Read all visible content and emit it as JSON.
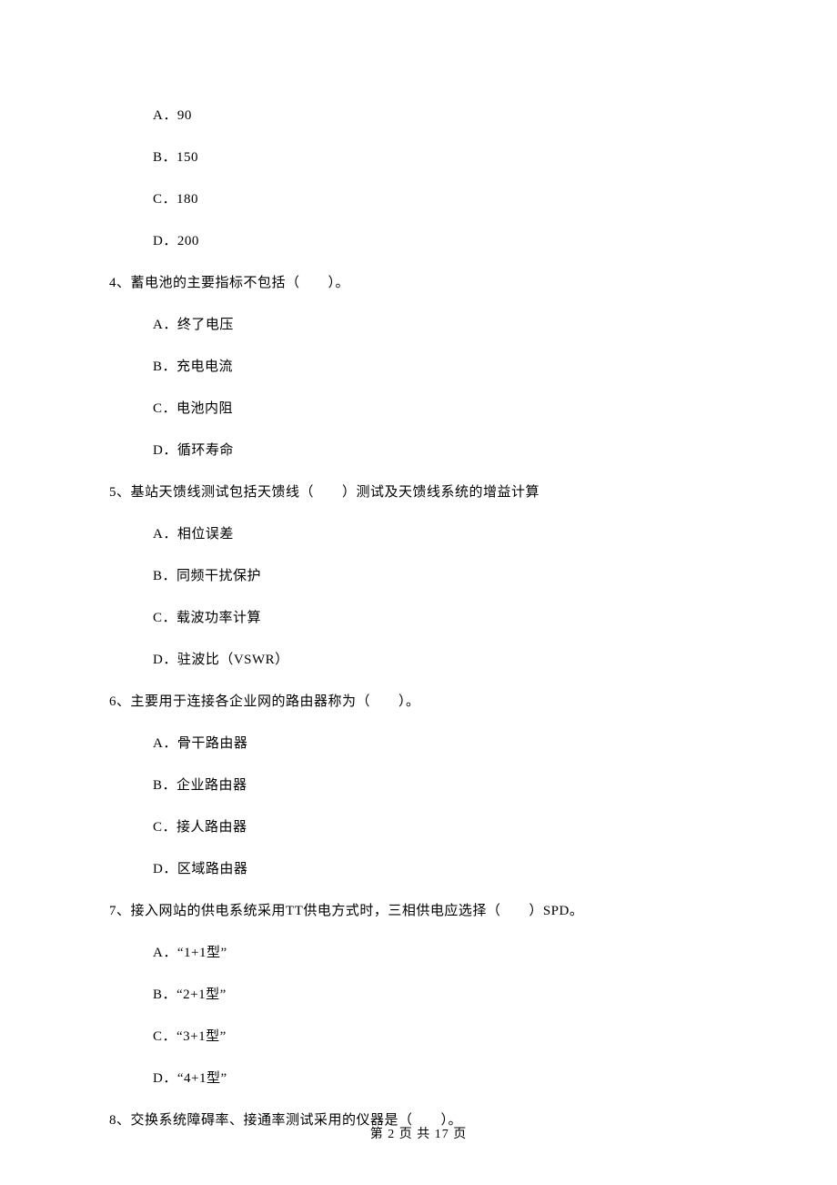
{
  "options_top": [
    "A．90",
    "B．150",
    "C．180",
    "D．200"
  ],
  "q4": {
    "text": "4、蓄电池的主要指标不包括（　　）。",
    "options": [
      "A．终了电压",
      "B．充电电流",
      "C．电池内阻",
      "D．循环寿命"
    ]
  },
  "q5": {
    "text": "5、基站天馈线测试包括天馈线（　　）测试及天馈线系统的增益计算",
    "options": [
      "A．相位误差",
      "B．同频干扰保护",
      "C．载波功率计算",
      "D．驻波比（VSWR）"
    ]
  },
  "q6": {
    "text": "6、主要用于连接各企业网的路由器称为（　　）。",
    "options": [
      "A．骨干路由器",
      "B．企业路由器",
      "C．接人路由器",
      "D．区域路由器"
    ]
  },
  "q7": {
    "text": "7、接入网站的供电系统采用TT供电方式时，三相供电应选择（　　）SPD。",
    "options": [
      "A．“1+1型”",
      "B．“2+1型”",
      "C．“3+1型”",
      "D．“4+1型”"
    ]
  },
  "q8": {
    "text": "8、交换系统障碍率、接通率测试采用的仪器是（　　）。"
  },
  "footer": "第 2 页 共 17 页"
}
